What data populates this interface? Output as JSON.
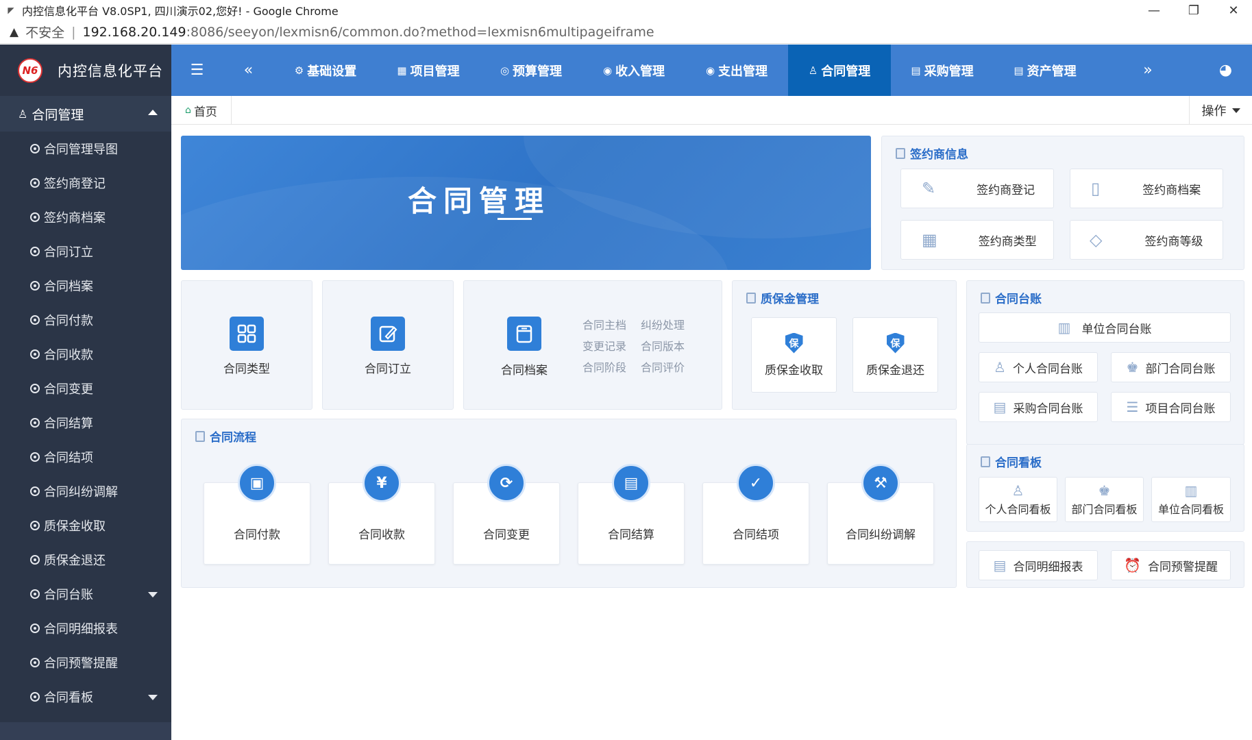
{
  "browser": {
    "title": "内控信息化平台 V8.0SP1, 四川演示02,您好! - Google Chrome",
    "insecure_label": "不安全",
    "url_host": "192.168.20.149",
    "url_rest": ":8086/seeyon/lexmisn6/common.do?method=lexmisn6multipageiframe",
    "min_glyph": "—",
    "max_glyph": "❐",
    "close_glyph": "✕"
  },
  "brand": {
    "logo_text": "N6",
    "name": "内控信息化平台"
  },
  "topnav": {
    "items": [
      {
        "label": "基础设置",
        "icon": "⚙"
      },
      {
        "label": "项目管理",
        "icon": "▦"
      },
      {
        "label": "预算管理",
        "icon": "◎"
      },
      {
        "label": "收入管理",
        "icon": "◉"
      },
      {
        "label": "支出管理",
        "icon": "◉"
      },
      {
        "label": "合同管理",
        "icon": "♙"
      },
      {
        "label": "采购管理",
        "icon": "▤"
      },
      {
        "label": "资产管理",
        "icon": "▤"
      }
    ]
  },
  "sidebar": {
    "header": "合同管理",
    "items": [
      "合同管理导图",
      "签约商登记",
      "签约商档案",
      "合同订立",
      "合同档案",
      "合同付款",
      "合同收款",
      "合同变更",
      "合同结算",
      "合同结项",
      "合同纠纷调解",
      "质保金收取",
      "质保金退还",
      "合同台账",
      "合同明细报表",
      "合同预警提醒",
      "合同看板"
    ]
  },
  "tabs": {
    "home": "首页",
    "ops": "操作"
  },
  "banner": {
    "title": "合同管理"
  },
  "signer": {
    "title": "签约商信息",
    "buttons": [
      "签约商登记",
      "签约商档案",
      "签约商类型",
      "签约商等级"
    ]
  },
  "tiles": {
    "type": "合同类型",
    "establish": "合同订立",
    "archive": "合同档案",
    "archive_links": [
      "合同主档",
      "纠纷处理",
      "变更记录",
      "合同版本",
      "合同阶段",
      "合同评价"
    ]
  },
  "warranty": {
    "title": "质保金管理",
    "shield_char": "保",
    "items": [
      "质保金收取",
      "质保金退还"
    ]
  },
  "ledger": {
    "title": "合同台账",
    "unit": "单位合同台账",
    "items": [
      "个人合同台账",
      "部门合同台账",
      "采购合同台账",
      "项目合同台账"
    ]
  },
  "process": {
    "title": "合同流程",
    "items": [
      {
        "label": "合同付款",
        "icon": "▣"
      },
      {
        "label": "合同收款",
        "icon": "¥"
      },
      {
        "label": "合同变更",
        "icon": "⟳"
      },
      {
        "label": "合同结算",
        "icon": "▤"
      },
      {
        "label": "合同结项",
        "icon": "✓"
      },
      {
        "label": "合同纠纷调解",
        "icon": "⚒"
      }
    ]
  },
  "kanban": {
    "title": "合同看板",
    "items": [
      "个人合同看板",
      "部门合同看板",
      "单位合同看板"
    ]
  },
  "reports": {
    "items": [
      "合同明细报表",
      "合同预警提醒"
    ]
  }
}
